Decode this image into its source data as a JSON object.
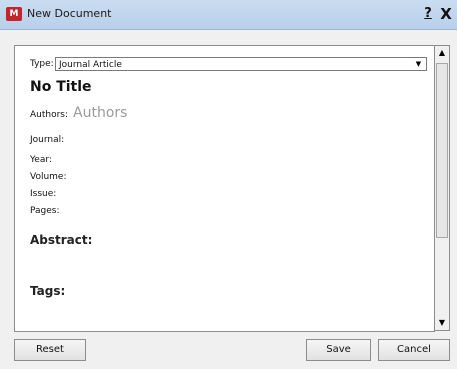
{
  "window": {
    "title": "New Document",
    "help_label": "?",
    "close_label": "X"
  },
  "form": {
    "type_label": "Type:",
    "type_value": "Journal Article",
    "doc_title": "No Title",
    "authors_label": "Authors:",
    "authors_placeholder": "Authors",
    "journal_label": "Journal:",
    "year_label": "Year:",
    "volume_label": "Volume:",
    "issue_label": "Issue:",
    "pages_label": "Pages:",
    "abstract_heading": "Abstract:",
    "tags_heading": "Tags:"
  },
  "buttons": {
    "reset": "Reset",
    "save": "Save",
    "cancel": "Cancel"
  },
  "icons": {
    "app": "mendeley-logo-icon",
    "dropdown": "dropdown-arrow-icon",
    "scroll_up": "scroll-up-arrow-icon",
    "scroll_down": "scroll-down-arrow-icon"
  },
  "colors": {
    "titlebar": "#c9dcf1",
    "app_icon": "#c0262b",
    "placeholder": "#9a9a9a"
  }
}
